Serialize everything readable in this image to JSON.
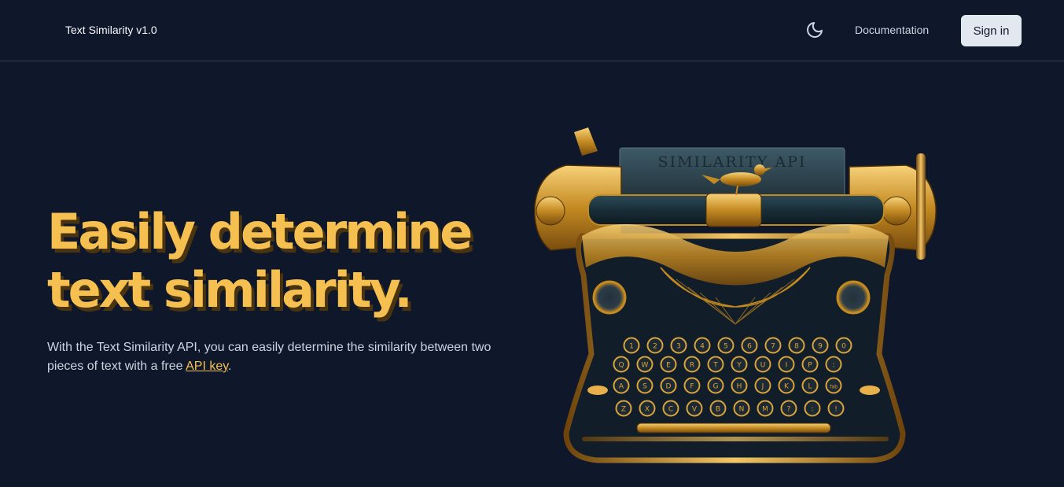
{
  "nav": {
    "brand": "Text Similarity v1.0",
    "theme_toggle_icon": "moon-icon",
    "documentation": "Documentation",
    "sign_in": "Sign in"
  },
  "hero": {
    "title_line1": "Easily determine",
    "title_line2": "text similarity.",
    "description_before": "With the Text Similarity API, you can easily determine the similarity between two pieces of text with a free ",
    "description_link": "API key",
    "description_after": "."
  },
  "illustration": {
    "paper_text": "SIMILARITY API",
    "key_rows": [
      [
        "1",
        "2",
        "3",
        "4",
        "5",
        "6",
        "7",
        "8",
        "9",
        "0"
      ],
      [
        "Q",
        "W",
        "E",
        "R",
        "T",
        "Y",
        "U",
        "I",
        "P",
        ":"
      ],
      [
        "A",
        "S",
        "D",
        "F",
        "G",
        "H",
        "J",
        "K",
        "L",
        "Tab"
      ],
      [
        "Z",
        "X",
        "C",
        "V",
        "B",
        "N",
        "M",
        "?",
        ":",
        "!"
      ]
    ]
  },
  "colors": {
    "background": "#0f172a",
    "accent": "#f6c050",
    "button_bg": "#e2e8f0"
  }
}
